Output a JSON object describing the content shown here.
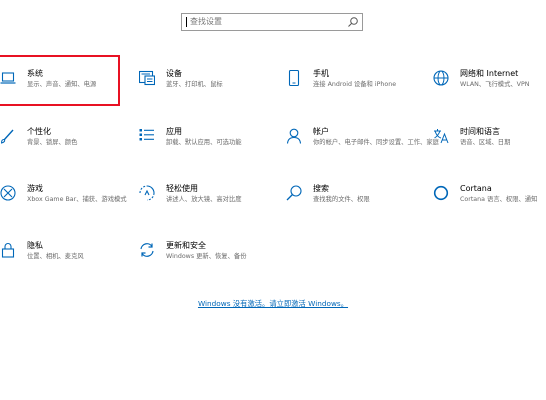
{
  "search": {
    "placeholder": "查找设置"
  },
  "tiles": [
    {
      "title": "系统",
      "desc": "显示、声音、通知、电源",
      "icon": "laptop-icon"
    },
    {
      "title": "设备",
      "desc": "蓝牙、打印机、鼠标",
      "icon": "keyboard-icon"
    },
    {
      "title": "手机",
      "desc": "连接 Android 设备和 iPhone",
      "icon": "phone-icon"
    },
    {
      "title": "网络和 Internet",
      "desc": "WLAN、飞行模式、VPN",
      "icon": "globe-icon"
    },
    {
      "title": "个性化",
      "desc": "背景、锁屏、颜色",
      "icon": "brush-icon"
    },
    {
      "title": "应用",
      "desc": "卸载、默认应用、可选功能",
      "icon": "apps-list-icon"
    },
    {
      "title": "帐户",
      "desc": "你的帐户、电子邮件、同步设置、工作、家庭",
      "icon": "person-icon"
    },
    {
      "title": "时间和语言",
      "desc": "语音、区域、日期",
      "icon": "language-icon"
    },
    {
      "title": "游戏",
      "desc": "Xbox Game Bar、捕获、游戏模式",
      "icon": "xbox-icon"
    },
    {
      "title": "轻松使用",
      "desc": "讲述人、放大镜、高对比度",
      "icon": "ease-of-access-icon"
    },
    {
      "title": "搜索",
      "desc": "查找我的文件、权限",
      "icon": "search-icon"
    },
    {
      "title": "Cortana",
      "desc": "Cortana 语言、权限、通知",
      "icon": "cortana-icon"
    },
    {
      "title": "隐私",
      "desc": "位置、相机、麦克风",
      "icon": "lock-icon"
    },
    {
      "title": "更新和安全",
      "desc": "Windows 更新、恢复、备份",
      "icon": "refresh-icon"
    }
  ],
  "activation_link": "Windows 没有激活。请立即激活 Windows。",
  "colors": {
    "accent": "#0067b8",
    "selection": "#e81123",
    "desc": "#6a6a6a"
  }
}
